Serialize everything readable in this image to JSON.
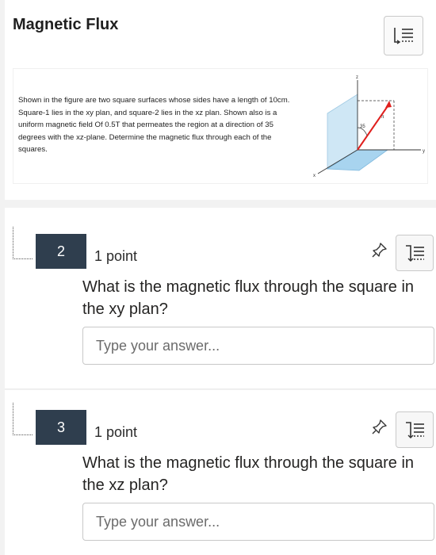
{
  "section": {
    "title": "Magnetic Flux",
    "problem_text": "Shown in the figure are two square surfaces whose sides have a length of 10cm. Square-1 lies in the xy plan, and square-2 lies in the xz plan. Shown also is a uniform magnetic field Of 0.5T that permeates the region at a direction of 35 degrees with the xz-plane. Determine the magnetic flux through each of the squares.",
    "figure": {
      "axis_z": "z",
      "axis_y": "y",
      "axis_x": "x",
      "angle_label": "35",
      "field_label": "π"
    }
  },
  "questions": [
    {
      "number": "2",
      "points": "1 point",
      "text": "What is the magnetic flux through the square in the xy plan?",
      "placeholder": "Type your answer..."
    },
    {
      "number": "3",
      "points": "1 point",
      "text": "What is the magnetic flux through the square in the xz plan?",
      "placeholder": "Type your answer..."
    }
  ],
  "icons": {
    "immersive_reader": "immersive-reader-icon",
    "pin": "pin-icon"
  },
  "colors": {
    "question_number_bg": "#2f3e4e",
    "page_bg": "#f2f2f2"
  }
}
